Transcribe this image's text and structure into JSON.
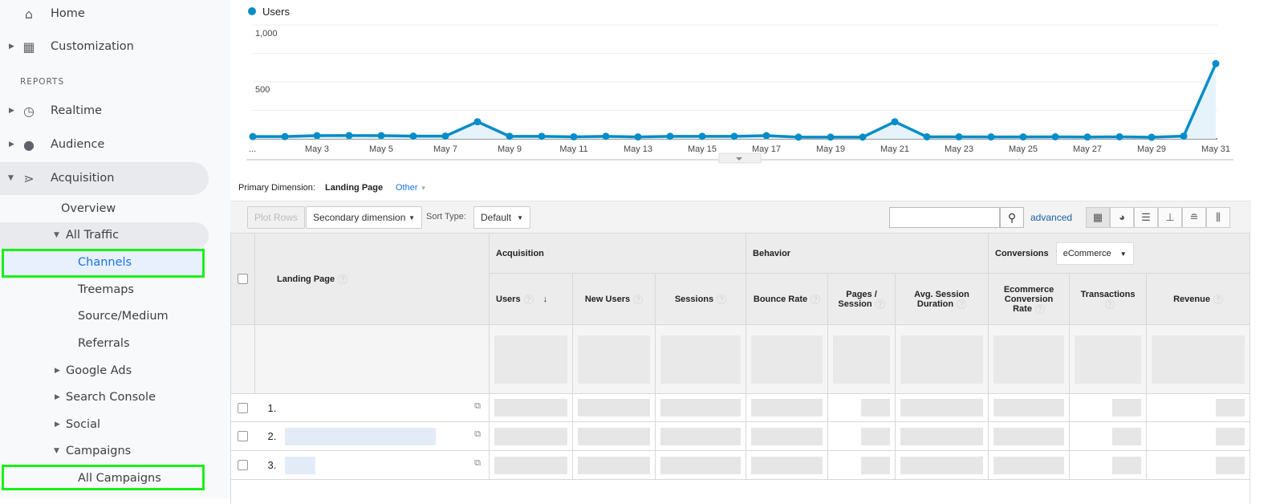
{
  "sidebar": {
    "home": "Home",
    "customization": "Customization",
    "reports_heading": "REPORTS",
    "realtime": "Realtime",
    "audience": "Audience",
    "acquisition": "Acquisition",
    "overview": "Overview",
    "all_traffic": "All Traffic",
    "channels": "Channels",
    "treemaps": "Treemaps",
    "source_medium": "Source/Medium",
    "referrals": "Referrals",
    "google_ads": "Google Ads",
    "search_console": "Search Console",
    "social": "Social",
    "campaigns": "Campaigns",
    "all_campaigns": "All Campaigns",
    "highlight_color": "#1aef1a",
    "active_color": "#1a73e8"
  },
  "chart_data": {
    "type": "area",
    "legend": "Users",
    "color": "#058dc7",
    "ylim": [
      0,
      1000
    ],
    "yticks": [
      "1,000",
      "500"
    ],
    "xtick_first": "...",
    "xticks": [
      "May 3",
      "May 5",
      "May 7",
      "May 9",
      "May 11",
      "May 13",
      "May 15",
      "May 17",
      "May 19",
      "May 21",
      "May 23",
      "May 25",
      "May 27",
      "May 29",
      "May 31"
    ],
    "x": [
      "May 1",
      "May 2",
      "May 3",
      "May 4",
      "May 5",
      "May 6",
      "May 7",
      "May 8",
      "May 9",
      "May 10",
      "May 11",
      "May 12",
      "May 13",
      "May 14",
      "May 15",
      "May 16",
      "May 17",
      "May 18",
      "May 19",
      "May 20",
      "May 21",
      "May 22",
      "May 23",
      "May 24",
      "May 25",
      "May 26",
      "May 27",
      "May 28",
      "May 29",
      "May 30",
      "May 31"
    ],
    "values": [
      20,
      20,
      28,
      29,
      28,
      24,
      24,
      150,
      22,
      22,
      18,
      22,
      17,
      22,
      22,
      22,
      28,
      15,
      15,
      15,
      150,
      18,
      18,
      17,
      17,
      18,
      16,
      18,
      14,
      24,
      660
    ]
  },
  "dimension": {
    "label": "Primary Dimension:",
    "active": "Landing Page",
    "other": "Other"
  },
  "toolbar": {
    "plot_rows": "Plot Rows",
    "secondary": "Secondary dimension",
    "sort_label": "Sort Type:",
    "sort_value": "Default",
    "search_placeholder": "",
    "advanced": "advanced"
  },
  "table": {
    "landing_page": "Landing Page",
    "acquisition": "Acquisition",
    "behavior": "Behavior",
    "conversions": "Conversions",
    "conversions_select": "eCommerce",
    "cols": [
      "Users",
      "New Users",
      "Sessions",
      "Bounce Rate",
      "Pages / Session",
      "Avg. Session Duration",
      "Ecommerce Conversion Rate",
      "Transactions",
      "Revenue"
    ],
    "rows": [
      "1.",
      "2.",
      "3."
    ]
  }
}
